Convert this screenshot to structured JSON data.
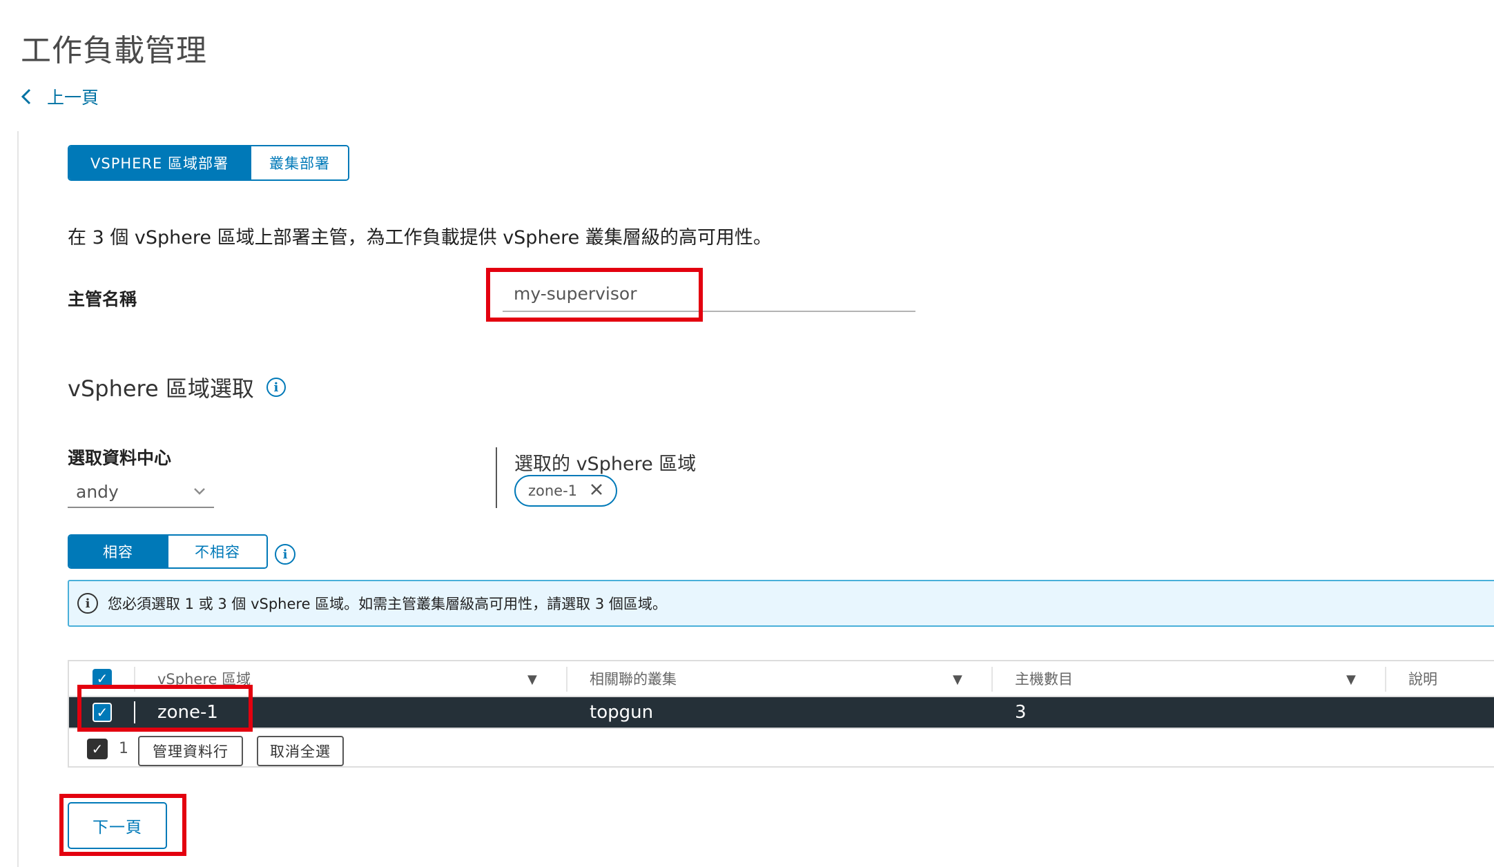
{
  "page": {
    "title": "工作負載管理",
    "back_label": "上一頁"
  },
  "deploy_mode": {
    "options": [
      "VSPHERE 區域部署",
      "叢集部署"
    ],
    "selected": "VSPHERE 區域部署"
  },
  "description": "在 3 個 vSphere 區域上部署主管，為工作負載提供 vSphere 叢集層級的高可用性。",
  "supervisor_name": {
    "label": "主管名稱",
    "value": "my-supervisor"
  },
  "zone_selection": {
    "title": "vSphere 區域選取",
    "datacenter_label": "選取資料中心",
    "datacenter_value": "andy",
    "selected_label": "選取的 vSphere 區域",
    "selected_chips": [
      "zone-1"
    ],
    "compat_options": [
      "相容",
      "不相容"
    ],
    "compat_selected": "相容",
    "alert_text": "您必須選取 1 或 3 個 vSphere 區域。如需主管叢集層級高可用性，請選取 3 個區域。"
  },
  "grid": {
    "columns": [
      "vSphere 區域",
      "相關聯的叢集",
      "主機數目",
      "說明"
    ],
    "rows": [
      {
        "zone": "zone-1",
        "cluster": "topgun",
        "hosts": "3",
        "desc": ""
      }
    ],
    "selected_count": "1",
    "manage_columns_label": "管理資料行",
    "deselect_all_label": "取消全選"
  },
  "next_label": "下一頁",
  "colors": {
    "primary": "#0079b8",
    "selected_row": "#253038",
    "highlight_box": "#e3000f"
  },
  "icons": [
    "chevron-left-icon",
    "info-icon",
    "chevron-down-icon",
    "close-icon",
    "filter-icon",
    "checkbox-checked-icon"
  ]
}
